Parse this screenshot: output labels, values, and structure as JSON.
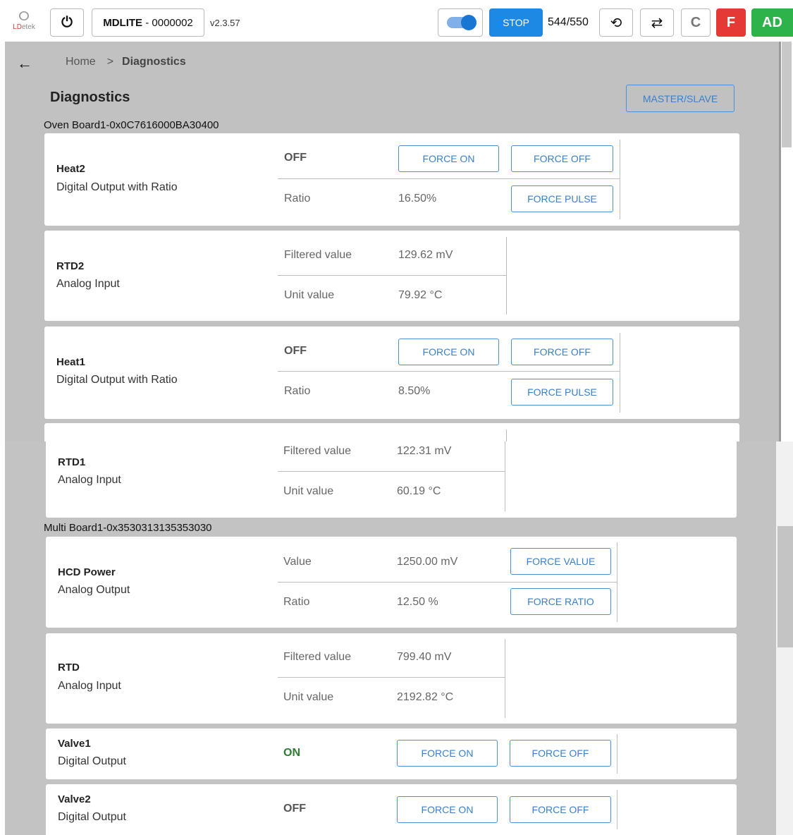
{
  "header": {
    "logo_glyph": "ⵔ",
    "logo_text_a": "LD",
    "logo_text_b": "etek",
    "power_icon": "⏻",
    "device_model": "MDLITE",
    "device_serial": "- 0000002",
    "version": "v2.3.57",
    "stop_label": "STOP",
    "counter": "544/550",
    "history_icon": "⟲",
    "swap_icon": "⇄",
    "c_label": "C",
    "f_label": "F",
    "ad_label": "AD",
    "colors": {
      "stop": "#1e88e5",
      "f": "#e53935",
      "ad": "#2eb24a",
      "toggle": "#1976d2"
    }
  },
  "nav": {
    "back_icon": "←",
    "breadcrumb_home": "Home",
    "breadcrumb_sep": ">",
    "breadcrumb_current": "Diagnostics"
  },
  "page": {
    "title": "Diagnostics",
    "master_slave_label": "MASTER/SLAVE"
  },
  "boards": [
    {
      "label": "Oven Board1-0x0C7616000BA30400"
    },
    {
      "label": "Multi Board1-0x3530313135353030"
    }
  ],
  "cards": {
    "heat2": {
      "name": "Heat2",
      "type": "Digital Output with Ratio",
      "state": "OFF",
      "ratio_label": "Ratio",
      "ratio_value": "16.50%",
      "force_on": "FORCE ON",
      "force_off": "FORCE OFF",
      "force_pulse": "FORCE PULSE"
    },
    "rtd2": {
      "name": "RTD2",
      "type": "Analog Input",
      "filtered_label": "Filtered value",
      "filtered_value": "129.62 mV",
      "unit_label": "Unit value",
      "unit_value": "79.92 °C"
    },
    "heat1": {
      "name": "Heat1",
      "type": "Digital Output with Ratio",
      "state": "OFF",
      "ratio_label": "Ratio",
      "ratio_value": "8.50%",
      "force_on": "FORCE ON",
      "force_off": "FORCE OFF",
      "force_pulse": "FORCE PULSE"
    },
    "rtd1": {
      "name": "RTD1",
      "type": "Analog Input",
      "filtered_label": "Filtered value",
      "filtered_value": "122.31 mV",
      "unit_label": "Unit value",
      "unit_value": "60.19 °C"
    },
    "hcd": {
      "name": "HCD Power",
      "type": "Analog Output",
      "value_label": "Value",
      "value_value": "1250.00 mV",
      "ratio_label": "Ratio",
      "ratio_value": "12.50 %",
      "force_value": "FORCE VALUE",
      "force_ratio": "FORCE RATIO"
    },
    "rtd": {
      "name": "RTD",
      "type": "Analog Input",
      "filtered_label": "Filtered value",
      "filtered_value": "799.40 mV",
      "unit_label": "Unit value",
      "unit_value": "2192.82 °C"
    },
    "valve1": {
      "name": "Valve1",
      "type": "Digital Output",
      "state": "ON",
      "force_on": "FORCE ON",
      "force_off": "FORCE OFF"
    },
    "valve2": {
      "name": "Valve2",
      "type": "Digital Output",
      "state": "OFF",
      "force_on": "FORCE ON",
      "force_off": "FORCE OFF"
    }
  }
}
